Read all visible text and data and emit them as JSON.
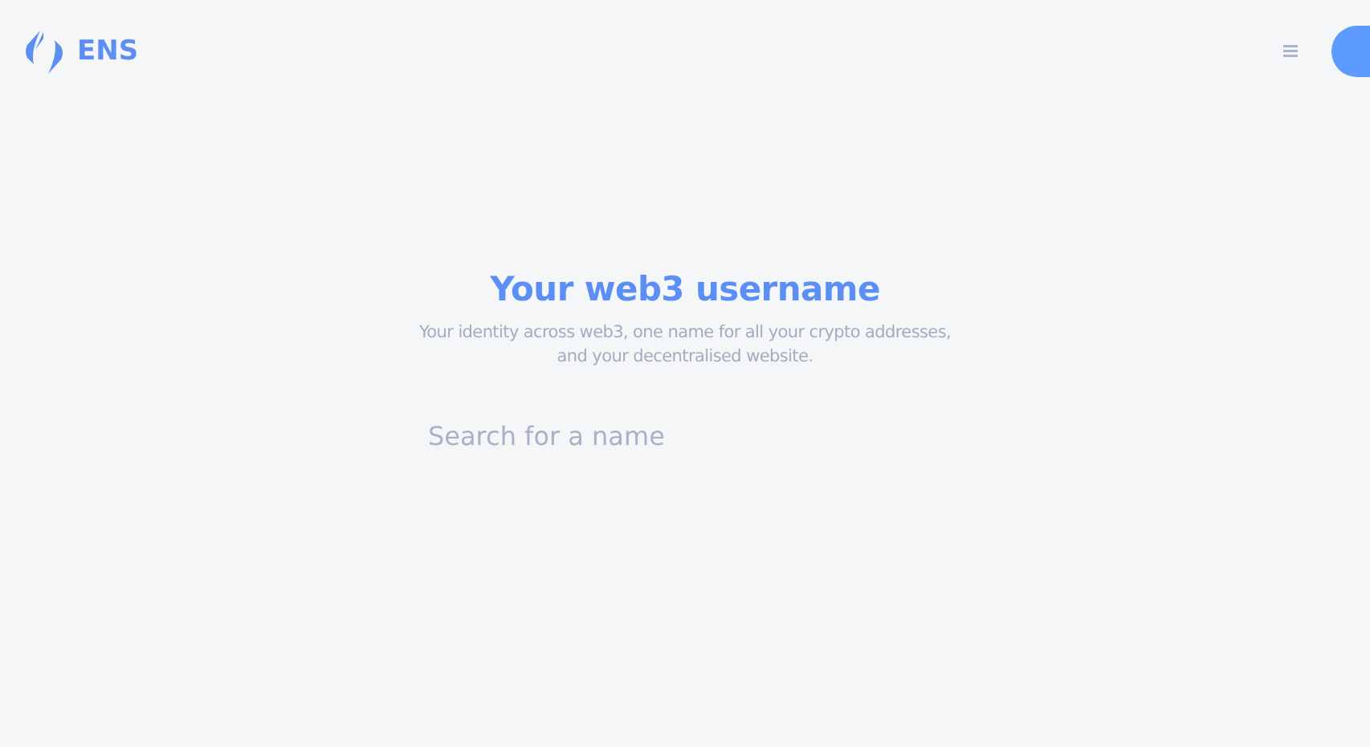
{
  "header": {
    "logo_text": "ENS"
  },
  "hero": {
    "title": "Your web3 username",
    "subtitle": [
      "Your identity across web3, one name for all your crypto addresses,",
      "and your decentralised website."
    ]
  },
  "search": {
    "placeholder": "Search for a name"
  }
}
